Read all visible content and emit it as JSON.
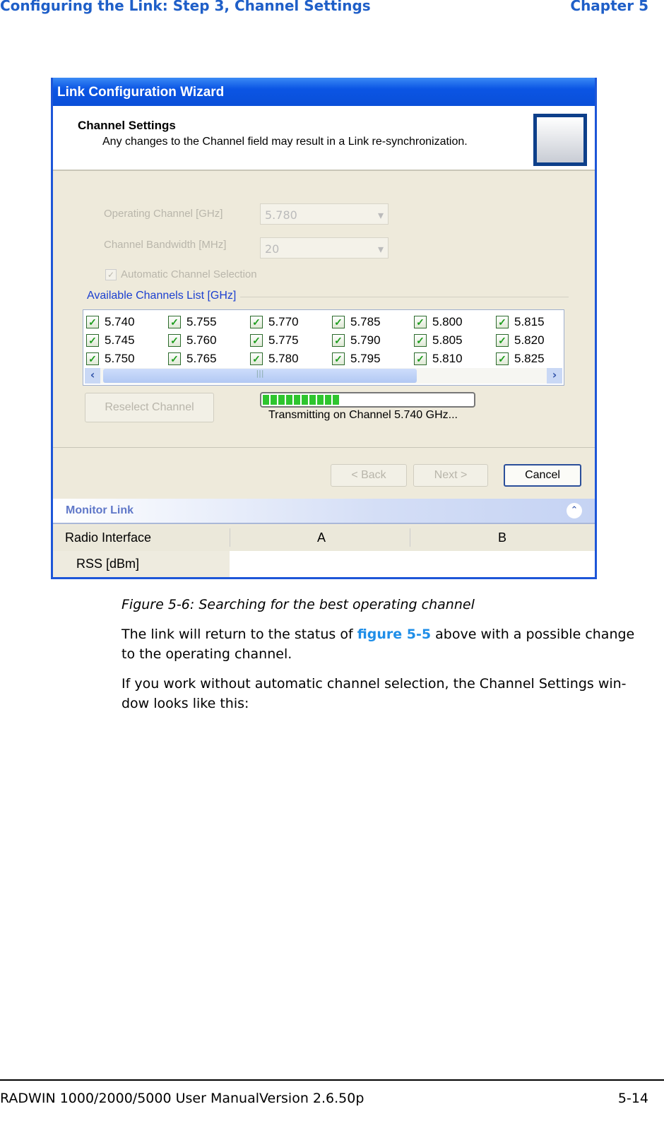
{
  "page_header": {
    "left": "Configuring the Link: Step 3, Channel Settings",
    "right": "Chapter 5"
  },
  "dialog": {
    "title": "Link Configuration Wizard",
    "section_title": "Channel Settings",
    "section_desc": "Any changes to the Channel field may result in a Link re-synchronization.",
    "operating_channel_label": "Operating Channel [GHz]",
    "operating_channel_value": "5.780",
    "bandwidth_label": "Channel Bandwidth [MHz]",
    "bandwidth_value": "20",
    "auto_select_label": "Automatic Channel Selection",
    "auto_select_checked": true,
    "channels_group_label": "Available Channels List [GHz]",
    "channels": [
      "5.740",
      "5.745",
      "5.750",
      "5.755",
      "5.760",
      "5.765",
      "5.770",
      "5.775",
      "5.780",
      "5.785",
      "5.790",
      "5.795",
      "5.800",
      "5.805",
      "5.810",
      "5.815",
      "5.820",
      "5.825"
    ],
    "reselect_label": "Reselect Channel",
    "progress_percent": 37,
    "status_text": "Transmitting on Channel 5.740 GHz...",
    "back_label": "< Back",
    "next_label": "Next >",
    "cancel_label": "Cancel",
    "monitor_title": "Monitor Link",
    "table": {
      "headers": [
        "Radio Interface",
        "A",
        "B"
      ],
      "rows": [
        [
          "RSS [dBm]",
          "",
          ""
        ]
      ]
    },
    "accent": "#1d56d8"
  },
  "caption": "Figure 5-6: Searching for the best operating channel",
  "para1_pre": "The link will return to the status of ",
  "para1_link": "figure 5-5",
  "para1_post": " above with a possible change to the operating channel.",
  "para2": "If you work without automatic channel selection, the Channel Settings win-dow looks like this:",
  "footer": {
    "left": "RADWIN 1000/2000/5000 User ManualVersion  2.6.50p",
    "right": "5-14"
  }
}
